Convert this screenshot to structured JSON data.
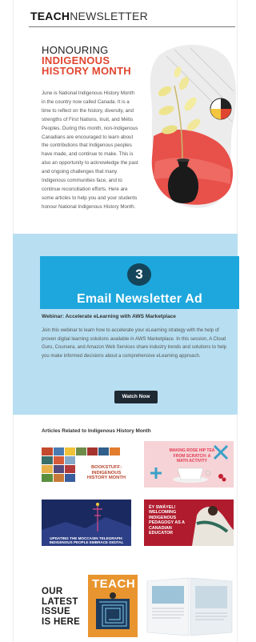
{
  "masthead": {
    "bold": "TEACH",
    "light": "NEWSLETTER"
  },
  "hero": {
    "title_line1": "HONOURING",
    "title_line2": "INDIGENOUS",
    "title_line3": "HISTORY MONTH",
    "body": "June is National Indigenous History Month in the country now called Canada. It is a time to reflect on the history, diversity, and strengths of First Nations, Inuit, and Métis Peoples. During this month, non-Indigenous Canadians are encouraged to learn about the contributions that Indigenous peoples have made, and continue to make. This is also an opportunity to acknowledge the past and ongoing challenges that many Indigenous communities face, and to continue reconciliation efforts. Here are some articles to help you and your students honour National Indigenous History Month."
  },
  "ad": {
    "number": "3",
    "label": "Email Newsletter Ad",
    "webinar_title": "Webinar: Accelerate eLearning with AWS Marketplace",
    "webinar_body": "Join this webinar to learn how to accelerate your eLearning strategy with the help of proven digital learning solutions available in AWS Marketplace. In this session, A Cloud Guru, Coursera, and Amazon Web Services share industry trends and solutions to help you make informed decisions about a comprehensive eLearning approach.",
    "button_label": "Watch Now"
  },
  "articles": {
    "title": "Articles Related to Indigenous History Month",
    "cards": [
      {
        "text": "BOOKSTUFF: INDIGENOUS HISTORY MONTH"
      },
      {
        "text": "MAKING ROSE HIP TEA FROM SCRATCH: A MATH ACTIVITY"
      },
      {
        "text": "UPDATING THE MOCCASIN TELEGRAPH: INDIGENOUS PEOPLE EMBRACE DIGITAL"
      },
      {
        "text": "ÉY SWÁYEL! WELCOMING INDIGENOUS PEDAGOGY AS A CANADIAN EDUCATOR"
      }
    ]
  },
  "issue": {
    "line1": "OUR",
    "line2": "LATEST",
    "line3": "ISSUE",
    "line4": "IS HERE",
    "cover_logo": "TEACH"
  },
  "colors": {
    "accent_red": "#e0452f",
    "ad_band": "#b7dff1",
    "ad_box": "#1ea7dc",
    "ad_badge": "#14455a",
    "button": "#1f2933"
  }
}
